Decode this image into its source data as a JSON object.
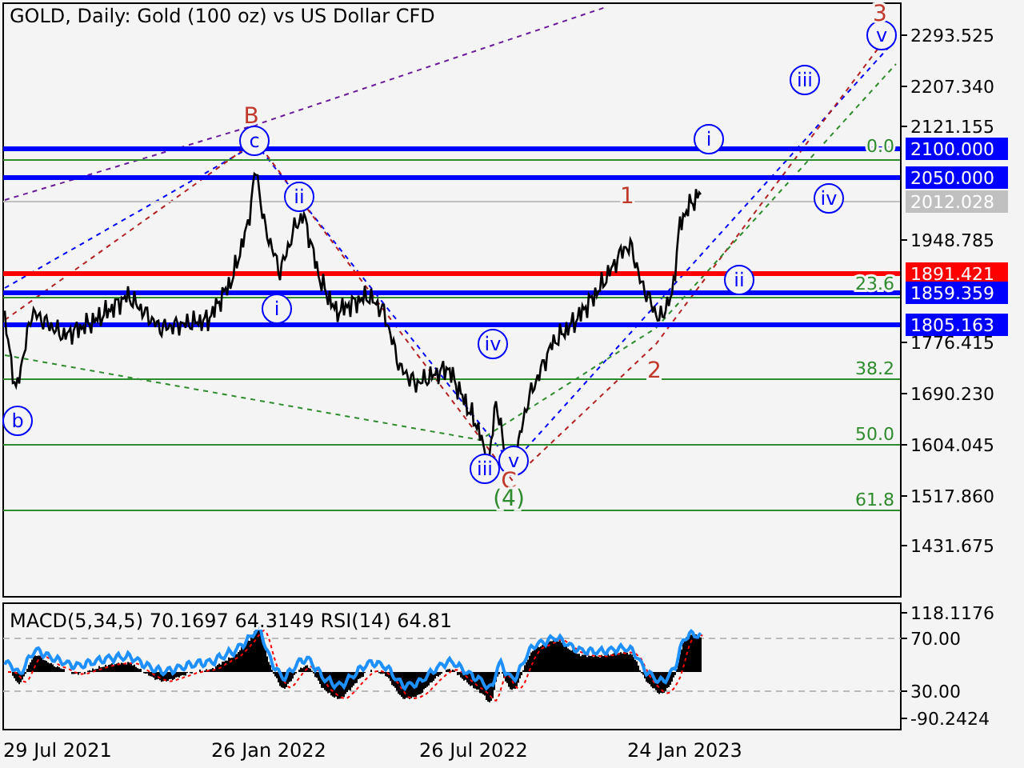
{
  "chart": {
    "title": "GOLD, Daily:  Gold (100 oz) vs US Dollar CFD",
    "price_ticks": [
      "2293.525",
      "2207.340",
      "2121.155",
      "1948.785",
      "1776.415",
      "1690.230",
      "1604.045",
      "1517.860",
      "1431.675"
    ],
    "level_labels": [
      {
        "text": "2100.000",
        "color": "#0000ff"
      },
      {
        "text": "2050.000",
        "color": "#0000ff"
      },
      {
        "text": "2012.028",
        "color": "#c0c0c0"
      },
      {
        "text": "1891.421",
        "color": "#ff0000"
      },
      {
        "text": "1859.359",
        "color": "#0000ff"
      },
      {
        "text": "1805.163",
        "color": "#0000ff"
      }
    ],
    "fib_levels": [
      "0.0",
      "23.6",
      "38.2",
      "50.0",
      "61.8"
    ],
    "wave_labels": [
      {
        "text": "B",
        "kind": "plain",
        "color": "#c0392b"
      },
      {
        "text": "c",
        "kind": "circled",
        "color": "#0000ff"
      },
      {
        "text": "ii",
        "kind": "circled",
        "color": "#0000ff"
      },
      {
        "text": "i",
        "kind": "circled",
        "color": "#0000ff"
      },
      {
        "text": "b",
        "kind": "circled",
        "color": "#0000ff"
      },
      {
        "text": "iv",
        "kind": "circled",
        "color": "#0000ff"
      },
      {
        "text": "iii",
        "kind": "circled",
        "color": "#0000ff"
      },
      {
        "text": "v",
        "kind": "circled",
        "color": "#0000ff"
      },
      {
        "text": "C",
        "kind": "plain",
        "color": "#c0392b"
      },
      {
        "text": "(4)",
        "kind": "plain",
        "color": "#2e8b2e"
      },
      {
        "text": "1",
        "kind": "plain",
        "color": "#c0392b"
      },
      {
        "text": "2",
        "kind": "plain",
        "color": "#c0392b"
      },
      {
        "text": "i",
        "kind": "circled",
        "color": "#0000ff"
      },
      {
        "text": "ii",
        "kind": "circled",
        "color": "#0000ff"
      },
      {
        "text": "iii",
        "kind": "circled",
        "color": "#0000ff"
      },
      {
        "text": "iv",
        "kind": "circled",
        "color": "#0000ff"
      },
      {
        "text": "v",
        "kind": "circled",
        "color": "#0000ff"
      },
      {
        "text": "3",
        "kind": "plain",
        "color": "#c0392b"
      }
    ]
  },
  "indicator": {
    "title": "MACD(5,34,5) 70.1697 64.3149 RSI(14) 64.81",
    "ticks": [
      "118.1176",
      "70.00",
      "30.00",
      "-90.2424"
    ]
  },
  "time_labels": [
    "29 Jul 2021",
    "26 Jan 2022",
    "26 Jul 2022",
    "24 Jan 2023"
  ]
}
